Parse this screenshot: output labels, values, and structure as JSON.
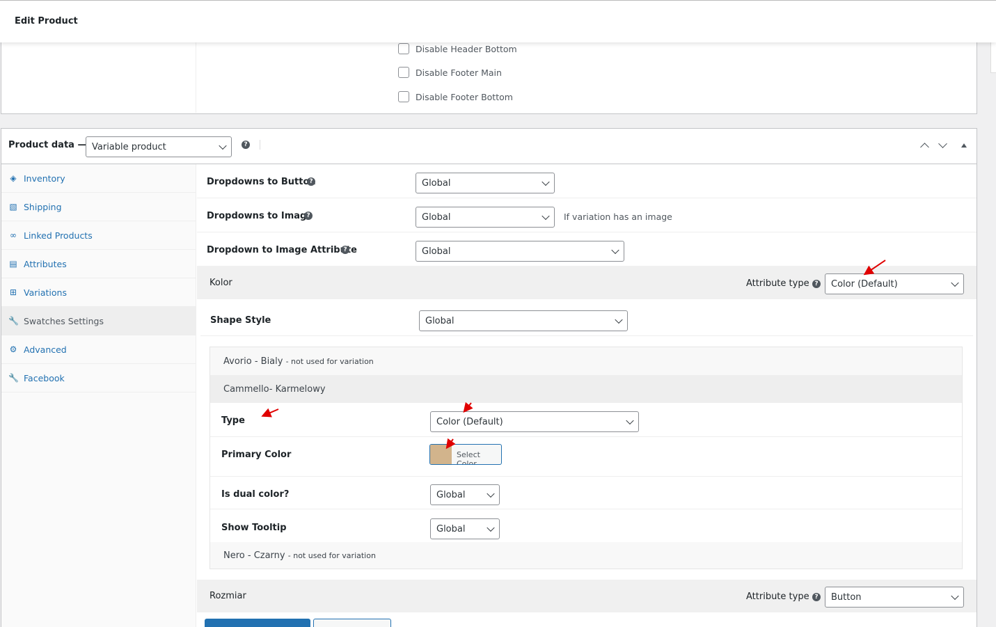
{
  "page": {
    "title": "Edit Product"
  },
  "top_options": [
    {
      "label": "Disable Header Bottom",
      "checked": false
    },
    {
      "label": "Disable Footer Main",
      "checked": false
    },
    {
      "label": "Disable Footer Bottom",
      "checked": false
    }
  ],
  "product_data": {
    "title": "Product data —",
    "type_select": "Variable product",
    "help": "?"
  },
  "tabs": [
    {
      "label": "Inventory",
      "icon": "tag-icon"
    },
    {
      "label": "Shipping",
      "icon": "truck-icon"
    },
    {
      "label": "Linked Products",
      "icon": "link-icon"
    },
    {
      "label": "Attributes",
      "icon": "list-icon"
    },
    {
      "label": "Variations",
      "icon": "grid-icon"
    },
    {
      "label": "Swatches Settings",
      "icon": "wrench-icon",
      "active": true
    },
    {
      "label": "Advanced",
      "icon": "gear-icon"
    },
    {
      "label": "Facebook",
      "icon": "wrench-icon"
    }
  ],
  "swatches": {
    "dropdowns_to_button": {
      "label": "Dropdowns to Button",
      "value": "Global"
    },
    "dropdowns_to_image": {
      "label": "Dropdowns to Image",
      "value": "Global",
      "desc": "If variation has an image"
    },
    "dropdown_to_image_attribute": {
      "label": "Dropdown to Image Attribute",
      "value": "Global"
    },
    "attribute_type_label": "Attribute type",
    "kolor": {
      "name": "Kolor",
      "attribute_type": "Color (Default)",
      "shape_style_label": "Shape Style",
      "shape_style_value": "Global",
      "terms": {
        "avorio": {
          "name": "Avorio - Bialy",
          "note": "- not used for variation"
        },
        "cammello": {
          "name": "Cammello- Karmelowy",
          "type_label": "Type",
          "type_value": "Color (Default)",
          "primary_color_label": "Primary Color",
          "primary_color": "#d2b48c",
          "select_color": "Select Color",
          "dual_color_label": "Is dual color?",
          "dual_color_value": "Global",
          "tooltip_label": "Show Tooltip",
          "tooltip_value": "Global"
        },
        "nero": {
          "name": "Nero - Czarny",
          "note": "- not used for variation"
        }
      }
    },
    "rozmiar": {
      "name": "Rozmiar",
      "attribute_type": "Button"
    }
  },
  "colors": {
    "accent": "#2271b1",
    "annotation_arrow": "#e00000"
  }
}
